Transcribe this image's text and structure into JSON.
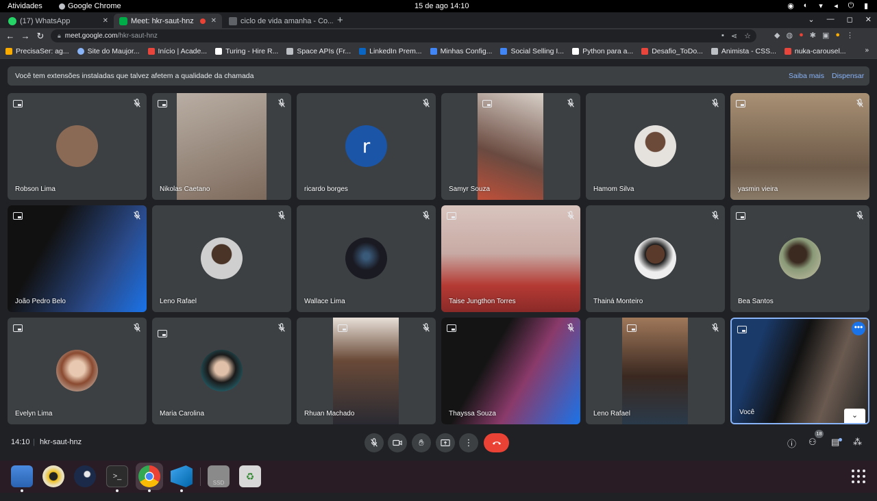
{
  "system_bar": {
    "activities": "Atividades",
    "app_name": "Google Chrome",
    "datetime": "15 de ago  14:10"
  },
  "tabs": [
    {
      "label": "(17) WhatsApp",
      "icon": "whatsapp-icon",
      "color": "#25d366"
    },
    {
      "label": "Meet: hkr-saut-hnz",
      "icon": "meet-icon",
      "color": "#00ac47",
      "active": true
    },
    {
      "label": "ciclo de vida amanha - Co...",
      "icon": "doc-icon",
      "color": "#5f6368"
    }
  ],
  "address_bar": {
    "domain": "meet.google.com",
    "path": "/hkr-saut-hnz"
  },
  "bookmarks": [
    {
      "label": "PrecisaSer: ag...",
      "color": "#f9ab00"
    },
    {
      "label": "Site do Maujor...",
      "color": "#8ab4f8"
    },
    {
      "label": "Início | Acade...",
      "color": "#e8453c"
    },
    {
      "label": "Turing - Hire R...",
      "color": "#ffffff"
    },
    {
      "label": "Space APIs (Fr...",
      "color": "#bdc1c6"
    },
    {
      "label": "LinkedIn Prem...",
      "color": "#0a66c2"
    },
    {
      "label": "Minhas Config...",
      "color": "#4285f4"
    },
    {
      "label": "Social Selling I...",
      "color": "#4285f4"
    },
    {
      "label": "Python para a...",
      "color": "#ffffff"
    },
    {
      "label": "Desafio_ToDo...",
      "color": "#e8453c"
    },
    {
      "label": "Animista - CSS...",
      "color": "#bdc1c6"
    },
    {
      "label": "nuka-carousel...",
      "color": "#e8453c"
    }
  ],
  "banner": {
    "text": "Você tem extensões instaladas que talvez afetem a qualidade da chamada",
    "learn_more": "Saiba mais",
    "dismiss": "Dispensar"
  },
  "participants": [
    {
      "name": "Robson Lima",
      "type": "avatar",
      "color": "#8a6a55"
    },
    {
      "name": "Nikolas Caetano",
      "type": "video",
      "color": "#a89b8e"
    },
    {
      "name": "ricardo borges",
      "type": "letter",
      "letter": "r"
    },
    {
      "name": "Samyr Souza",
      "type": "video",
      "color": "#7a5e55"
    },
    {
      "name": "Hamom Silva",
      "type": "avatar",
      "color": "#d9d4cf"
    },
    {
      "name": "yasmin vieira",
      "type": "video",
      "color": "#9c8670"
    },
    {
      "name": "João Pedro Belo",
      "type": "video",
      "color": "#2a3550"
    },
    {
      "name": "Leno Rafael",
      "type": "avatar",
      "color": "#6e6e6e"
    },
    {
      "name": "Wallace Lima",
      "type": "avatar",
      "color": "#1e1e28"
    },
    {
      "name": "Taise Jungthon Torres",
      "type": "video",
      "color": "#b4504a"
    },
    {
      "name": "Thainá Monteiro",
      "type": "avatar",
      "color": "#555555"
    },
    {
      "name": "Bea Santos",
      "type": "avatar",
      "color": "#7a8a6a"
    },
    {
      "name": "Evelyn Lima",
      "type": "avatar",
      "color": "#c8a28a"
    },
    {
      "name": "Maria Carolina",
      "type": "avatar",
      "color": "#3a6b7a"
    },
    {
      "name": "Rhuan Machado",
      "type": "video",
      "color": "#8a7a70"
    },
    {
      "name": "Thayssa Souza",
      "type": "video",
      "color": "#3a2040"
    },
    {
      "name": "Leno Rafael",
      "type": "video",
      "color": "#6a5040"
    },
    {
      "name": "Você",
      "type": "video",
      "color": "#2b4a6b",
      "self": true
    }
  ],
  "meeting": {
    "time": "14:10",
    "separator": "|",
    "code": "hkr-saut-hnz",
    "participant_count": "18"
  },
  "controls": [
    "mic-off-icon",
    "camera-icon",
    "raise-hand-icon",
    "present-icon",
    "more-options-icon",
    "end-call-icon"
  ]
}
